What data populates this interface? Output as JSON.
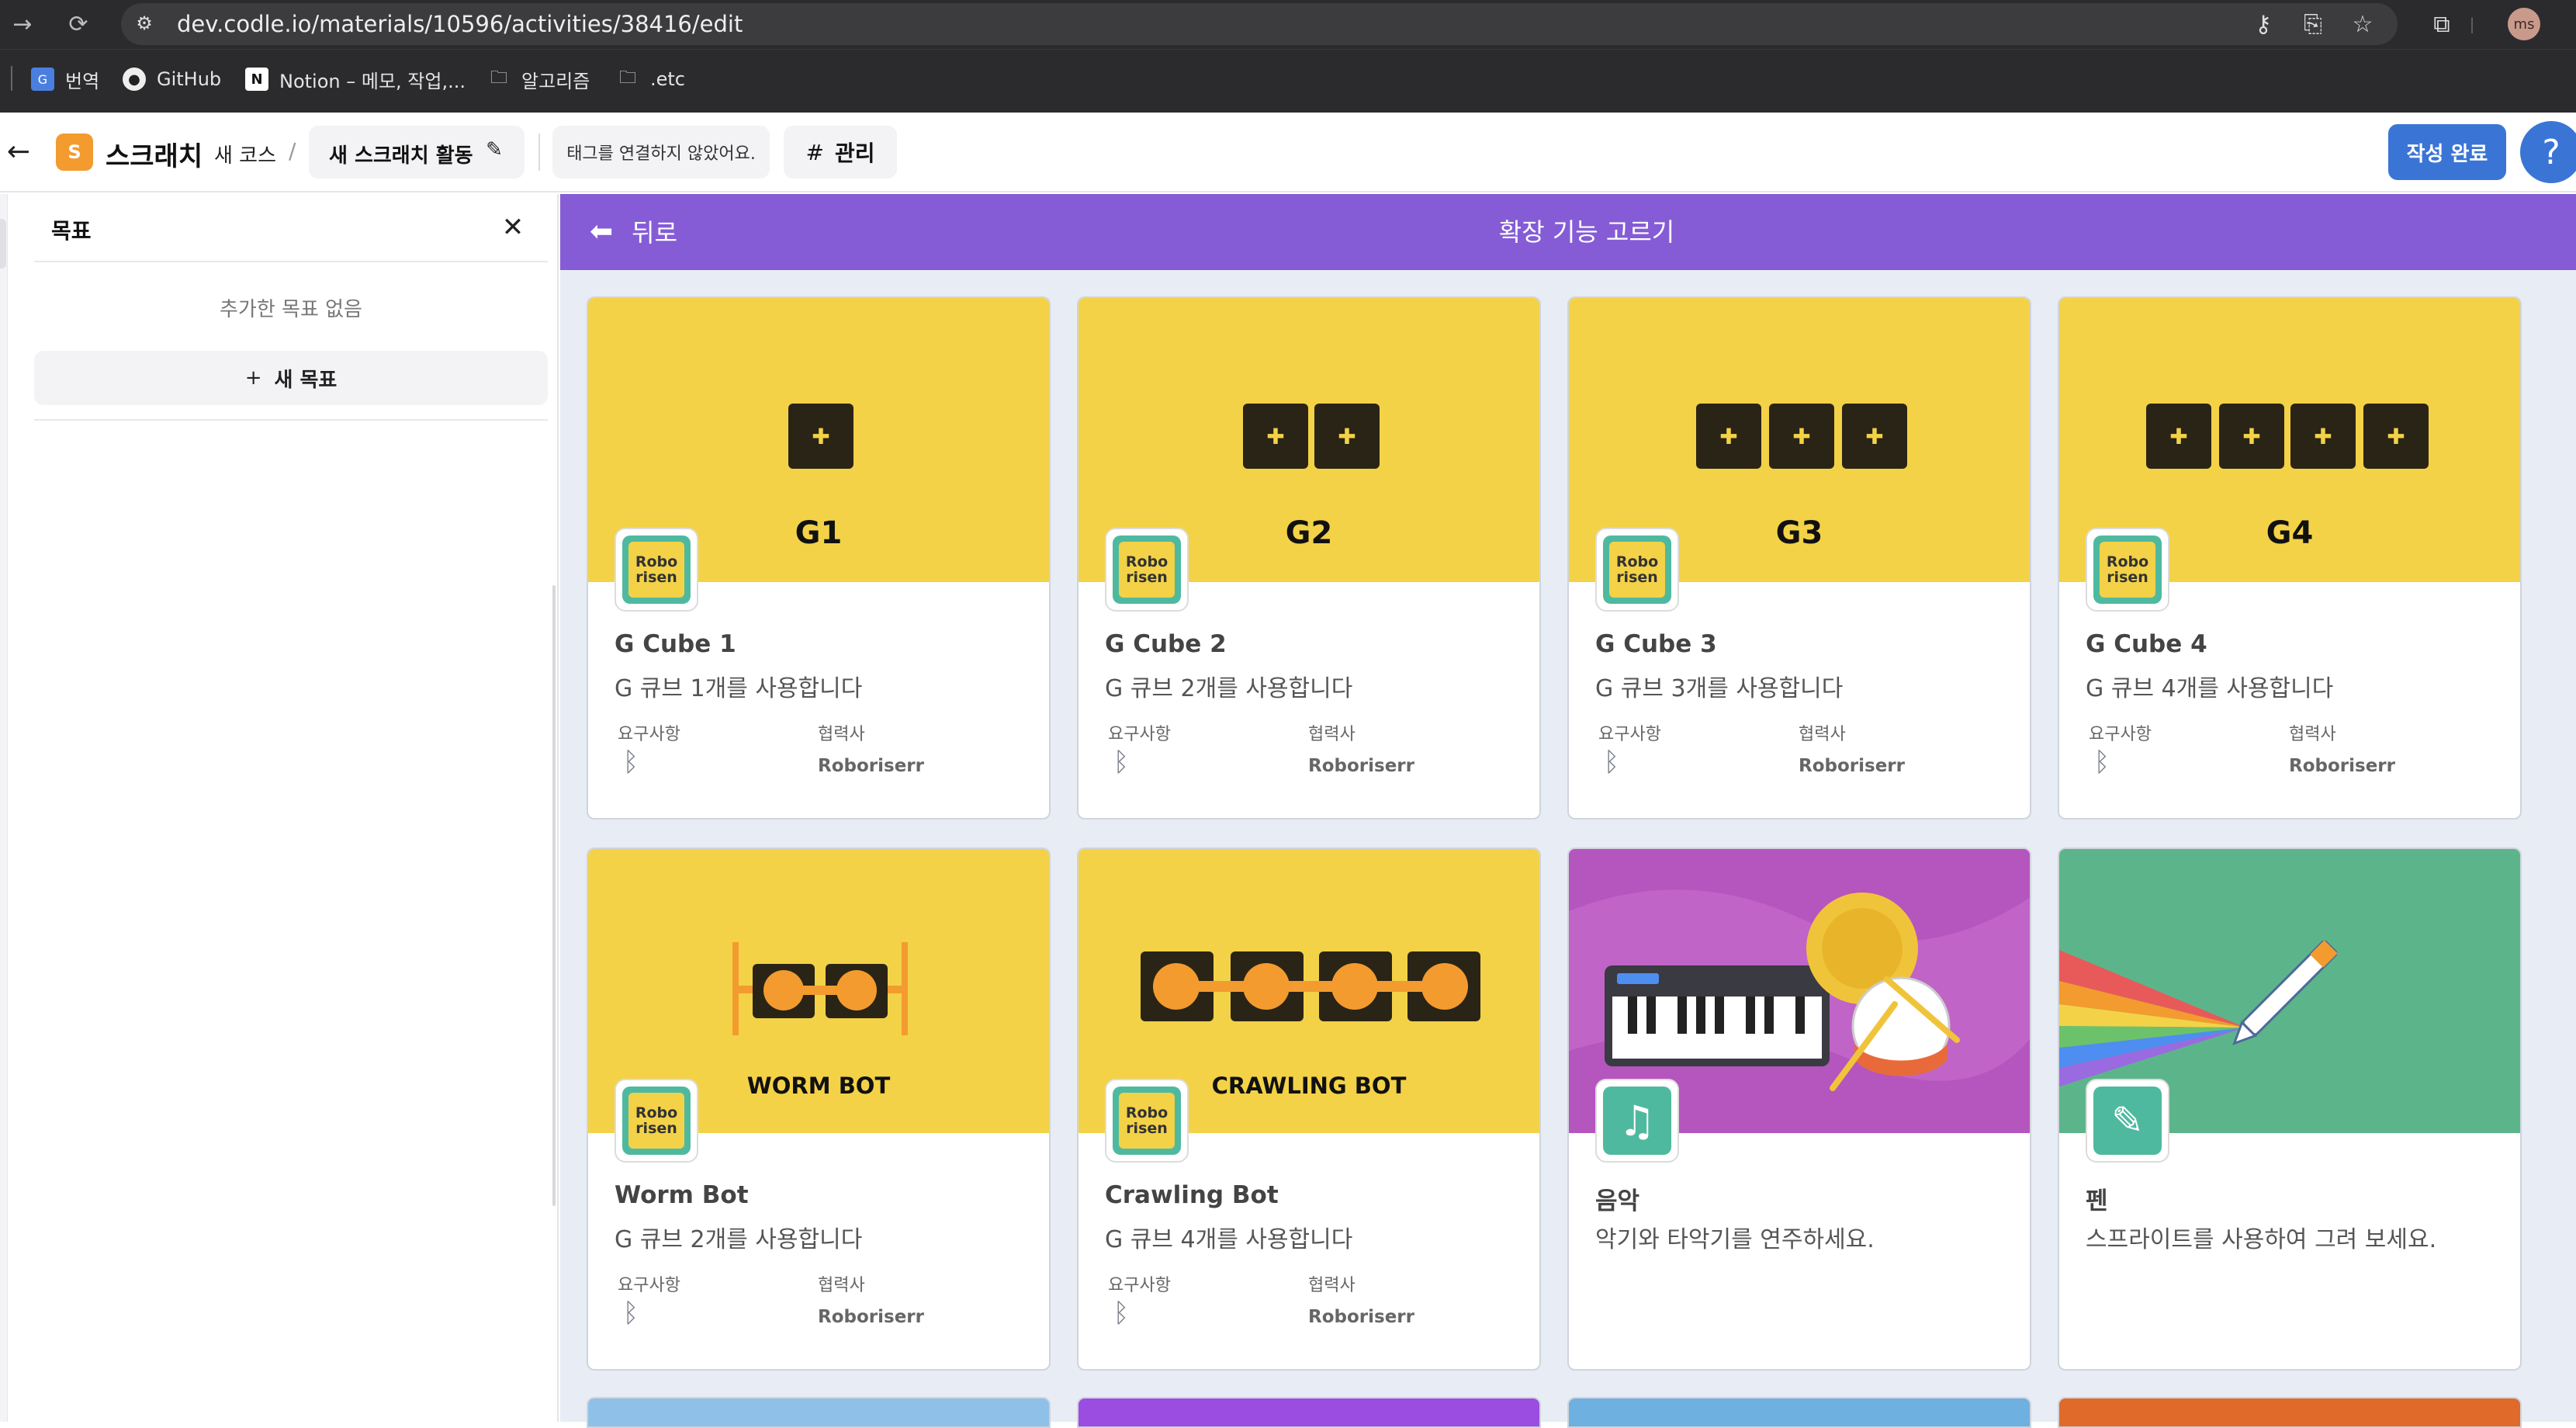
{
  "browser": {
    "url": "dev.codle.io/materials/10596/activities/38416/edit",
    "avatar": "ms",
    "bookmarks": [
      {
        "label": "번역"
      },
      {
        "label": "GitHub"
      },
      {
        "label": "Notion – 메모, 작업,..."
      },
      {
        "label": "알고리즘"
      },
      {
        "label": ".etc"
      }
    ]
  },
  "header": {
    "logo": "S",
    "app_name": "스크래치",
    "course": "새 코스",
    "separator": "/",
    "activity": "새 스크래치 활동",
    "tag_status": "태그를 연결하지 않았어요.",
    "manage": "관리",
    "manage_prefix": "#",
    "done": "작성 완료",
    "help": "?"
  },
  "sidebar": {
    "title": "목표",
    "empty_text": "추가한 목표 없음",
    "new_goal": "새 목표",
    "new_goal_prefix": "+"
  },
  "main": {
    "back": "뒤로",
    "title": "확장 기능 고르기"
  },
  "labels": {
    "requirements": "요구사항",
    "partner": "협력사"
  },
  "cards": [
    {
      "name": "G Cube 1",
      "desc": "G 큐브 1개를 사용합니다",
      "banner": "G1",
      "partner": "Roboriserr"
    },
    {
      "name": "G Cube 2",
      "desc": "G 큐브 2개를 사용합니다",
      "banner": "G2",
      "partner": "Roboriserr"
    },
    {
      "name": "G Cube 3",
      "desc": "G 큐브 3개를 사용합니다",
      "banner": "G3",
      "partner": "Roboriserr"
    },
    {
      "name": "G Cube 4",
      "desc": "G 큐브 4개를 사용합니다",
      "banner": "G4",
      "partner": "Roboriserr"
    },
    {
      "name": "Worm Bot",
      "desc": "G 큐브 2개를 사용합니다",
      "banner": "WORM BOT",
      "partner": "Roboriserr"
    },
    {
      "name": "Crawling Bot",
      "desc": "G 큐브 4개를 사용합니다",
      "banner": "CRAWLING BOT",
      "partner": "Roboriserr"
    },
    {
      "name": "음악",
      "desc": "악기와 타악기를 연주하세요."
    },
    {
      "name": "펜",
      "desc": "스프라이트를 사용하여 그려 보세요."
    }
  ],
  "robo_logo": {
    "line1": "Robo",
    "line2": "risen"
  },
  "colors": {
    "purple": "#855cd6",
    "yellow": "#f3d247",
    "blue": "#3a75d6",
    "music_bg": "#c064c8",
    "pen_bg": "#5cb58a"
  },
  "icons": {
    "bluetooth": "ᛒ",
    "plus": "+",
    "close": "✕"
  }
}
